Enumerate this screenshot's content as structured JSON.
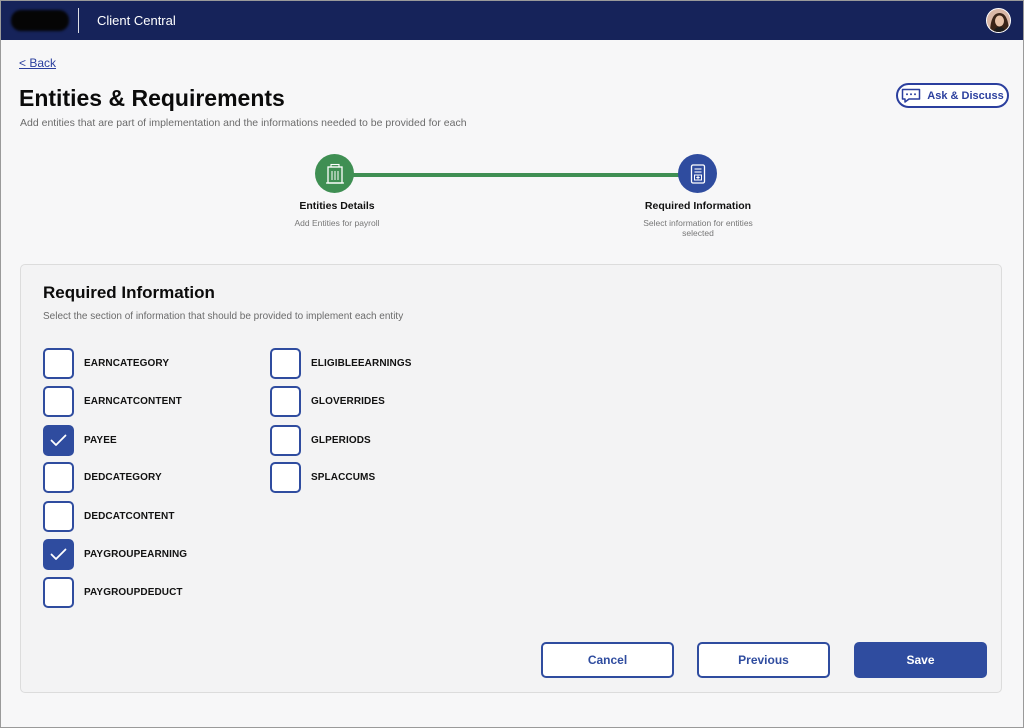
{
  "header": {
    "app_title": "Client Central"
  },
  "nav": {
    "back_label": "< Back"
  },
  "page": {
    "title": "Entities & Requirements",
    "subtitle": "Add entities that are part of implementation and the informations needed to be provided for each",
    "ask_label": "Ask & Discuss"
  },
  "stepper": {
    "steps": [
      {
        "label": "Entities Details",
        "description": "Add Entities for payroll",
        "status": "completed"
      },
      {
        "label": "Required Information",
        "description": "Select information for entities selected",
        "status": "current"
      }
    ]
  },
  "panel": {
    "title": "Required Information",
    "subtitle": "Select the section of information that should be provided to implement each entity",
    "options": [
      {
        "label": "EARNCATEGORY",
        "checked": false
      },
      {
        "label": "EARNCATCONTENT",
        "checked": false
      },
      {
        "label": "PAYEE",
        "checked": true
      },
      {
        "label": "DEDCATEGORY",
        "checked": false
      },
      {
        "label": "DEDCATCONTENT",
        "checked": false
      },
      {
        "label": "PAYGROUPEARNING",
        "checked": true
      },
      {
        "label": "PAYGROUPDEDUCT",
        "checked": false
      },
      {
        "label": "ELIGIBLEEARNINGS",
        "checked": false
      },
      {
        "label": "GLOVERRIDES",
        "checked": false
      },
      {
        "label": "GLPERIODS",
        "checked": false
      },
      {
        "label": "SPLACCUMS",
        "checked": false
      }
    ]
  },
  "actions": {
    "cancel_label": "Cancel",
    "previous_label": "Previous",
    "save_label": "Save"
  },
  "colors": {
    "header_bg": "#16235a",
    "accent": "#2f4c9f",
    "success": "#3f8f53"
  },
  "icons": {
    "ask": "chat-bubble-icon",
    "step1": "building-icon",
    "step2": "document-icon",
    "check": "checkmark-icon"
  }
}
